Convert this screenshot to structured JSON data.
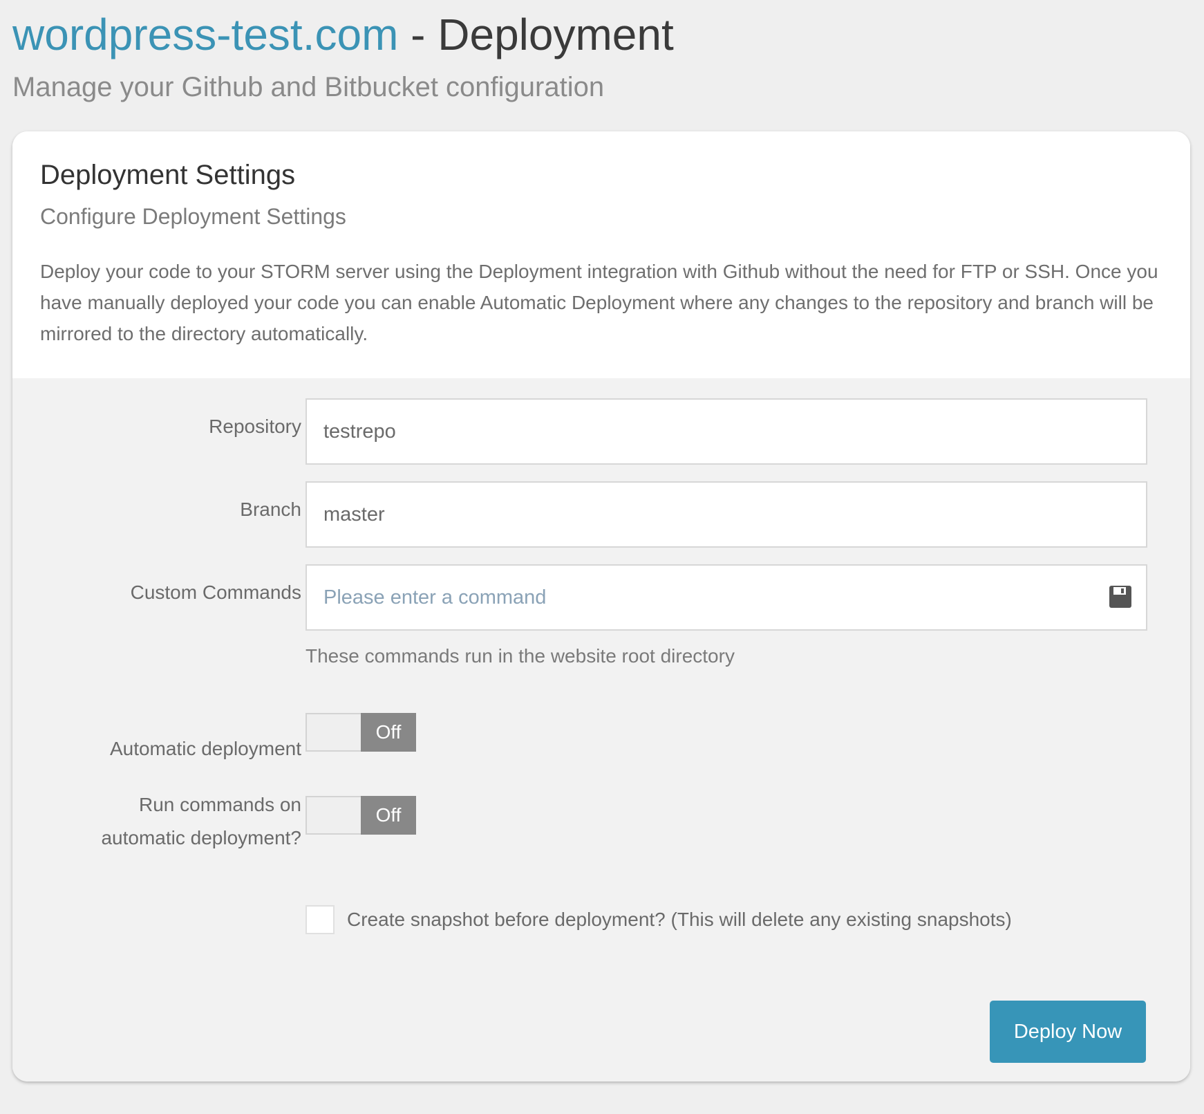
{
  "header": {
    "site_link": "wordpress-test.com",
    "separator": " - ",
    "title": "Deployment",
    "subtitle": "Manage your Github and Bitbucket configuration"
  },
  "card": {
    "heading": "Deployment Settings",
    "subheading": "Configure Deployment Settings",
    "description": "Deploy your code to your STORM server using the Deployment integration with Github without the need for FTP or SSH. Once you have manually deployed your code you can enable Automatic Deployment where any changes to the repository and branch will be mirrored to the directory automatically."
  },
  "form": {
    "repository": {
      "label": "Repository",
      "value": "testrepo"
    },
    "branch": {
      "label": "Branch",
      "value": "master"
    },
    "custom_commands": {
      "label": "Custom Commands",
      "value": "",
      "placeholder": "Please enter a command",
      "icon": "save-icon",
      "help": "These commands run in the website root directory"
    },
    "automatic_deployment": {
      "label": "Automatic deployment",
      "state": "Off",
      "enabled": false
    },
    "run_commands": {
      "label_line1": "Run commands on",
      "label_line2": "automatic deployment?",
      "state": "Off",
      "enabled": false
    },
    "snapshot": {
      "label": "Create snapshot before deployment? (This will delete any existing snapshots)",
      "checked": false
    },
    "deploy_button": "Deploy Now"
  },
  "colors": {
    "link": "#3b93b5",
    "primary_button": "#3795b8",
    "toggle_off": "#888888",
    "page_background": "#efefef",
    "form_background": "#f2f2f2"
  }
}
